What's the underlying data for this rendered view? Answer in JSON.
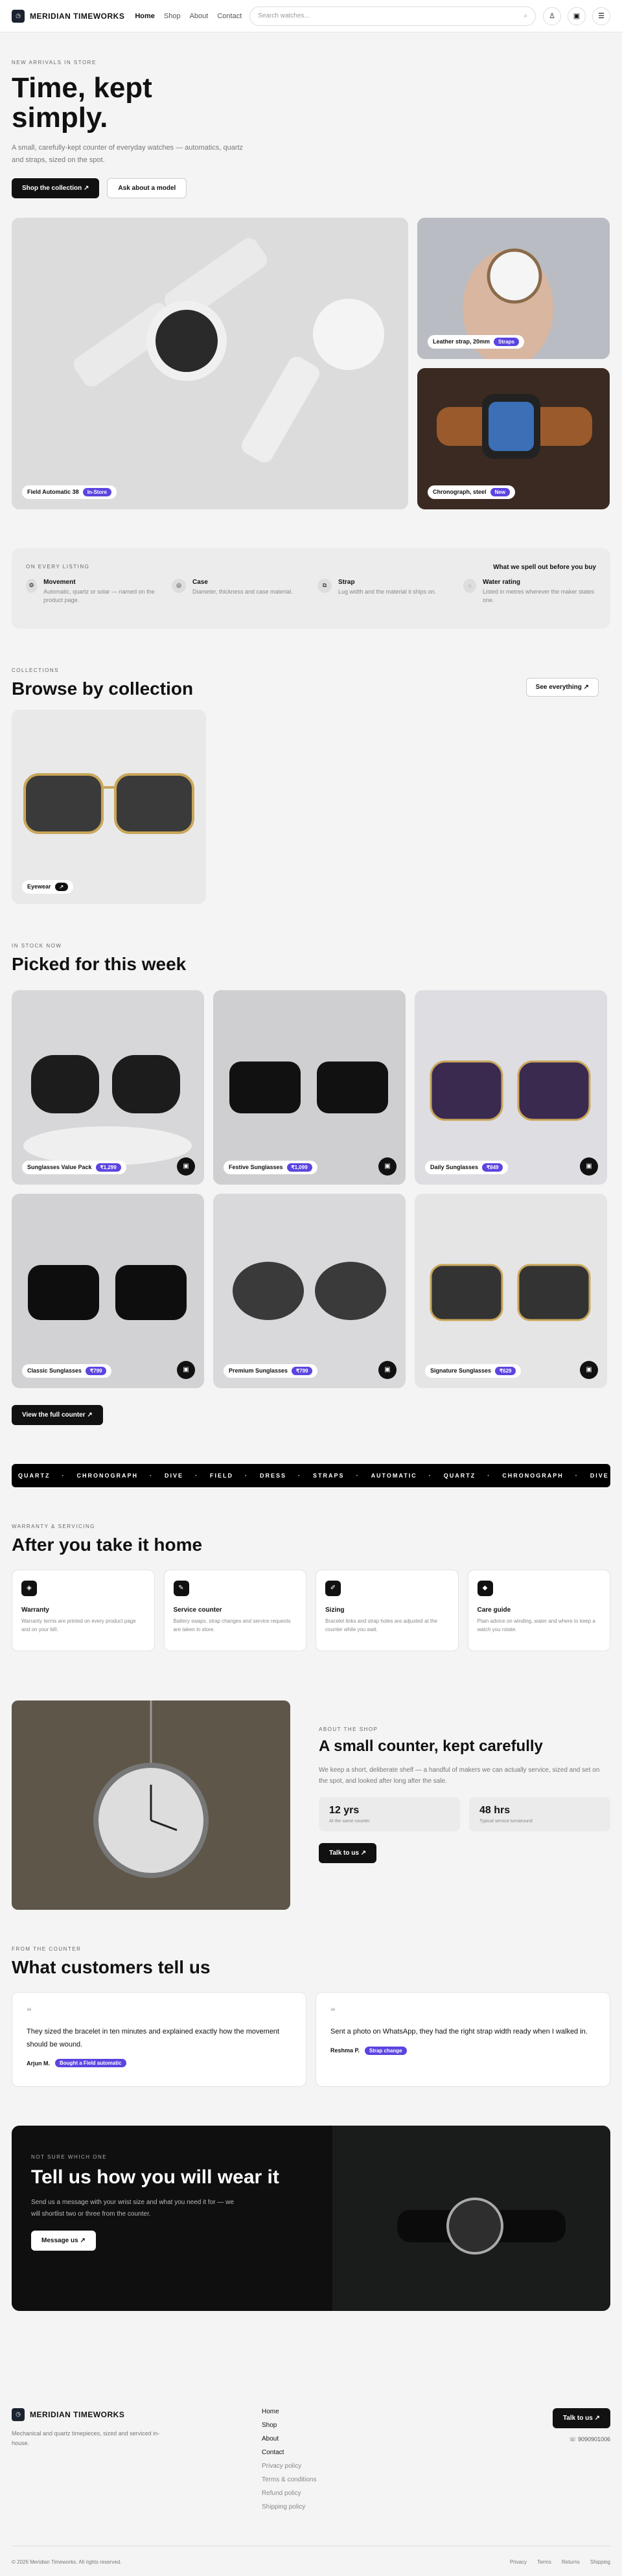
{
  "brand": {
    "name": "MERIDIAN TIMEWORKS",
    "footer_desc": "Mechanical and quartz timepieces, sized and serviced in-house."
  },
  "nav": [
    "Home",
    "Shop",
    "About",
    "Contact"
  ],
  "search": {
    "placeholder": "Search watches..."
  },
  "icons": {
    "search": "search-icon",
    "user": "user-icon",
    "bag": "bag-icon",
    "menu": "menu-icon"
  },
  "hero": {
    "eyebrow": "NEW ARRIVALS IN STORE",
    "title": "Time, kept simply.",
    "lead": "A small, carefully-kept counter of everyday watches — automatics, quartz and straps, sized on the spot.",
    "cta_primary": "Shop the collection",
    "cta_secondary": "Ask about a model",
    "tags": [
      {
        "label": "Field Automatic 38",
        "pill": "In-Store"
      },
      {
        "label": "Leather strap, 20mm",
        "pill": "Straps"
      },
      {
        "label": "Chronograph, steel",
        "pill": "New"
      }
    ]
  },
  "spec": {
    "eyebrow": "ON EVERY LISTING",
    "aside": "What we spell out before you buy",
    "items": [
      {
        "t": "Movement",
        "d": "Automatic, quartz or solar — named on the product page."
      },
      {
        "t": "Case",
        "d": "Diameter, thickness and case material."
      },
      {
        "t": "Strap",
        "d": "Lug width and the material it ships on."
      },
      {
        "t": "Water rating",
        "d": "Listed in metres wherever the maker states one."
      }
    ]
  },
  "collections": {
    "eyebrow": "COLLECTIONS",
    "title": "Browse by collection",
    "see_all": "See everything",
    "items": [
      {
        "label": "Eyewear"
      }
    ]
  },
  "products": {
    "eyebrow": "IN STOCK NOW",
    "title": "Picked for this week",
    "view_all": "View the full counter",
    "items": [
      {
        "name": "Sunglasses Value Pack",
        "price": "₹1,299"
      },
      {
        "name": "Festive Sunglasses",
        "price": "₹1,099"
      },
      {
        "name": "Daily Sunglasses",
        "price": "₹849"
      },
      {
        "name": "Classic Sunglasses",
        "price": "₹799"
      },
      {
        "name": "Premium Sunglasses",
        "price": "₹799"
      },
      {
        "name": "Signature Sunglasses",
        "price": "₹629"
      }
    ]
  },
  "marquee": [
    "QUARTZ",
    "CHRONOGRAPH",
    "DIVE",
    "FIELD",
    "DRESS",
    "STRAPS",
    "AUTOMATIC",
    "QUARTZ",
    "CHRONOGRAPH",
    "DIVE"
  ],
  "services": {
    "eyebrow": "WARRANTY & SERVICING",
    "title": "After you take it home",
    "items": [
      {
        "t": "Warranty",
        "d": "Warranty terms are printed on every product page and on your bill."
      },
      {
        "t": "Service counter",
        "d": "Battery swaps, strap changes and service requests are taken in store."
      },
      {
        "t": "Sizing",
        "d": "Bracelet links and strap holes are adjusted at the counter while you wait."
      },
      {
        "t": "Care guide",
        "d": "Plain advice on winding, water and where to keep a watch you rotate."
      }
    ]
  },
  "about": {
    "eyebrow": "ABOUT THE SHOP",
    "title": "A small counter, kept carefully",
    "body": "We keep a short, deliberate shelf — a handful of makers we can actually service, sized and set on the spot, and looked after long after the sale.",
    "stats": [
      {
        "n": "12 yrs",
        "l": "At the same counter"
      },
      {
        "n": "48 hrs",
        "l": "Typical service turnaround"
      }
    ],
    "cta": "Talk to us"
  },
  "testimonials": {
    "eyebrow": "FROM THE COUNTER",
    "title": "What customers tell us",
    "items": [
      {
        "q": "They sized the bracelet in ten minutes and explained exactly how the movement should be wound.",
        "who": "Arjun M.",
        "pill": "Bought a Field automatic"
      },
      {
        "q": "Sent a photo on WhatsApp, they had the right strap width ready when I walked in.",
        "who": "Reshma P.",
        "pill": "Strap change"
      }
    ]
  },
  "cta": {
    "eyebrow": "NOT SURE WHICH ONE",
    "title": "Tell us how you will wear it",
    "body": "Send us a message with your wrist size and what you need it for — we will shortlist two or three from the counter.",
    "button": "Message us"
  },
  "footer": {
    "links": [
      "Home",
      "Shop",
      "About",
      "Contact"
    ],
    "legal": [
      "Privacy policy",
      "Terms & conditions",
      "Refund policy",
      "Shipping policy"
    ],
    "talk": "Talk to us",
    "phone": "9090901006",
    "copyright": "© 2026 Meridian Timeworks. All rights reserved.",
    "bottom_links": [
      "Privacy",
      "Terms",
      "Returns",
      "Shipping"
    ]
  },
  "colors": {
    "accent": "#5b45e0",
    "dark": "#111111",
    "bg": "#f4f4f4"
  }
}
